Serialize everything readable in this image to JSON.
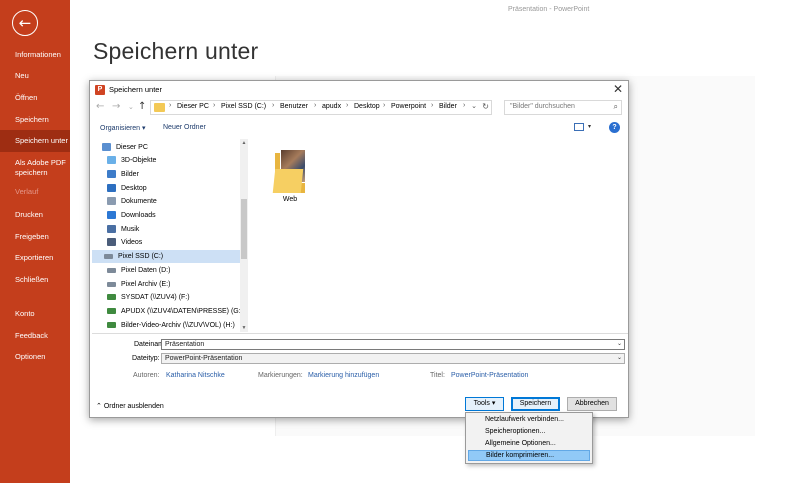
{
  "window_title": "Präsentation  -  PowerPoint",
  "backstage": {
    "back_icon": "back-arrow-icon",
    "items": [
      {
        "label": "Informationen"
      },
      {
        "label": "Neu"
      },
      {
        "label": "Öffnen"
      },
      {
        "label": "Speichern"
      },
      {
        "label": "Speichern unter"
      },
      {
        "label": "Als Adobe PDF\nspeichern"
      },
      {
        "label": "Verlauf"
      },
      {
        "label": "Drucken"
      },
      {
        "label": "Freigeben"
      },
      {
        "label": "Exportieren"
      },
      {
        "label": "Schließen"
      },
      {
        "label": "Konto"
      },
      {
        "label": "Feedback"
      },
      {
        "label": "Optionen"
      }
    ]
  },
  "page_title": "Speichern unter",
  "dialog": {
    "title": "Speichern unter",
    "app_icon_letter": "P",
    "close": "✕",
    "breadcrumbs": [
      "Dieser PC",
      "Pixel SSD (C:)",
      "Benutzer",
      "apudx",
      "Desktop",
      "Powerpoint",
      "Bilder"
    ],
    "search_placeholder": "\"Bilder\" durchsuchen",
    "toolbar": {
      "organize": "Organisieren ▾",
      "new_folder": "Neuer Ordner"
    },
    "tree": [
      {
        "label": "Dieser PC",
        "icon": "pc-icon",
        "color": "#5a8fd0"
      },
      {
        "label": "3D-Objekte",
        "icon": "cube-icon",
        "color": "#6ab0e8"
      },
      {
        "label": "Bilder",
        "icon": "pictures-icon",
        "color": "#3d7cc9"
      },
      {
        "label": "Desktop",
        "icon": "desktop-icon",
        "color": "#2d6fc0"
      },
      {
        "label": "Dokumente",
        "icon": "documents-icon",
        "color": "#8a9bb0"
      },
      {
        "label": "Downloads",
        "icon": "download-icon",
        "color": "#2c78d4"
      },
      {
        "label": "Musik",
        "icon": "music-icon",
        "color": "#4a6fa3"
      },
      {
        "label": "Videos",
        "icon": "video-icon",
        "color": "#4b5d7a"
      },
      {
        "label": "Pixel SSD (C:)",
        "icon": "drive-icon",
        "color": "#7d8a99"
      },
      {
        "label": "Pixel Daten (D:)",
        "icon": "drive-icon",
        "color": "#7d8a99"
      },
      {
        "label": "Pixel Archiv (E:)",
        "icon": "drive-icon",
        "color": "#7d8a99"
      },
      {
        "label": "SYSDAT (\\\\ZUV4) (F:)",
        "icon": "network-drive-icon",
        "color": "#3f8a3f"
      },
      {
        "label": "APUDX (\\\\ZUV4\\DATEN\\PRESSE) (G:)",
        "icon": "network-drive-icon",
        "color": "#3f8a3f"
      },
      {
        "label": "Bilder-Video-Archiv (\\\\ZUV\\VOL) (H:)",
        "icon": "network-drive-icon",
        "color": "#3f8a3f"
      }
    ],
    "folder": {
      "label": "Web"
    },
    "filename_label": "Dateiname:",
    "filename_value": "Präsentation",
    "filetype_label": "Dateityp:",
    "filetype_value": "PowerPoint-Präsentation",
    "authors_label": "Autoren:",
    "authors_value": "Katharina Nitschke",
    "tags_label": "Markierungen:",
    "tags_value": "Markierung hinzufügen",
    "title_label": "Titel:",
    "title_value": "PowerPoint-Präsentation",
    "hide_folders": "Ordner ausblenden",
    "tools_button": "Tools",
    "save_button": "Speichern",
    "cancel_button": "Abbrechen"
  },
  "tools_menu": [
    {
      "label": "Netzlaufwerk verbinden..."
    },
    {
      "label": "Speicheroptionen..."
    },
    {
      "label": "Allgemeine Optionen..."
    },
    {
      "label": "Bilder komprimieren..."
    }
  ]
}
